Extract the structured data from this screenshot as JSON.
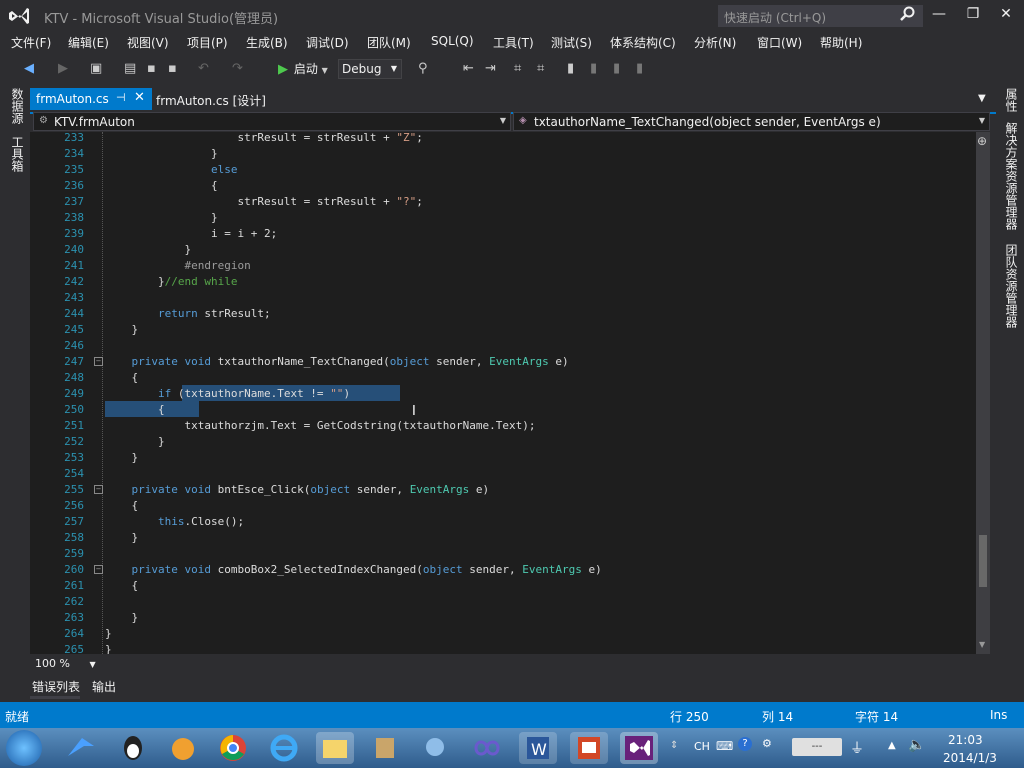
{
  "window": {
    "title": "KTV - Microsoft Visual Studio(管理员)",
    "quick_launch_placeholder": "快速启动 (Ctrl+Q)"
  },
  "menu": [
    "文件(F)",
    "编辑(E)",
    "视图(V)",
    "项目(P)",
    "生成(B)",
    "调试(D)",
    "团队(M)",
    "SQL(Q)",
    "工具(T)",
    "测试(S)",
    "体系结构(C)",
    "分析(N)",
    "窗口(W)",
    "帮助(H)"
  ],
  "toolbar": {
    "start_label": "启动",
    "config_label": "Debug"
  },
  "left_strip": [
    "数据源",
    "工具箱"
  ],
  "right_strip": [
    "属性",
    "解决方案资源管理器",
    "团队资源管理器"
  ],
  "tabs": [
    {
      "label": "frmAuton.cs",
      "active": true
    },
    {
      "label": "frmAuton.cs [设计]",
      "active": false
    }
  ],
  "nav": {
    "type": "KTV.frmAuton",
    "member": "txtauthorName_TextChanged(object sender, EventArgs e)"
  },
  "code": [
    {
      "n": "233",
      "t": "                    strResult = strResult + \"Z\";"
    },
    {
      "n": "234",
      "t": "                }"
    },
    {
      "n": "235",
      "t": "                else"
    },
    {
      "n": "236",
      "t": "                {"
    },
    {
      "n": "237",
      "t": "                    strResult = strResult + \"?\";"
    },
    {
      "n": "238",
      "t": "                }"
    },
    {
      "n": "239",
      "t": "                i = i + 2;"
    },
    {
      "n": "240",
      "t": "            }"
    },
    {
      "n": "241",
      "t": "            #endregion"
    },
    {
      "n": "242",
      "t": "        }//end while"
    },
    {
      "n": "243",
      "t": ""
    },
    {
      "n": "244",
      "t": "        return strResult;"
    },
    {
      "n": "245",
      "t": "    }"
    },
    {
      "n": "246",
      "t": ""
    },
    {
      "n": "247",
      "t": "    private void txtauthorName_TextChanged(object sender, EventArgs e)"
    },
    {
      "n": "248",
      "t": "    {"
    },
    {
      "n": "249",
      "t": "        if (txtauthorName.Text != \"\")"
    },
    {
      "n": "250",
      "t": "        {"
    },
    {
      "n": "251",
      "t": "            txtauthorzjm.Text = GetCodstring(txtauthorName.Text);"
    },
    {
      "n": "252",
      "t": "        }"
    },
    {
      "n": "253",
      "t": "    }"
    },
    {
      "n": "254",
      "t": ""
    },
    {
      "n": "255",
      "t": "    private void bntEsce_Click(object sender, EventArgs e)"
    },
    {
      "n": "256",
      "t": "    {"
    },
    {
      "n": "257",
      "t": "        this.Close();"
    },
    {
      "n": "258",
      "t": "    }"
    },
    {
      "n": "259",
      "t": ""
    },
    {
      "n": "260",
      "t": "    private void comboBox2_SelectedIndexChanged(object sender, EventArgs e)"
    },
    {
      "n": "261",
      "t": "    {"
    },
    {
      "n": "262",
      "t": ""
    },
    {
      "n": "263",
      "t": "    }"
    },
    {
      "n": "264",
      "t": "}"
    },
    {
      "n": "265",
      "t": "}"
    }
  ],
  "zoom": "100 %",
  "bottom_tabs": [
    "错误列表",
    "输出"
  ],
  "status": {
    "ready": "就绪",
    "line": "行 250",
    "col": "列 14",
    "ch": "字符 14",
    "mode": "Ins"
  },
  "taskbar": {
    "lang": "CH",
    "time": "21:03",
    "date": "2014/1/3"
  },
  "colors": {
    "accent": "#007acc",
    "editor_bg": "#1e1e1e",
    "chrome_bg": "#2d2d30",
    "keyword": "#569cd6",
    "type": "#4ec9b0",
    "string": "#d69d85",
    "comment": "#57a64a"
  }
}
